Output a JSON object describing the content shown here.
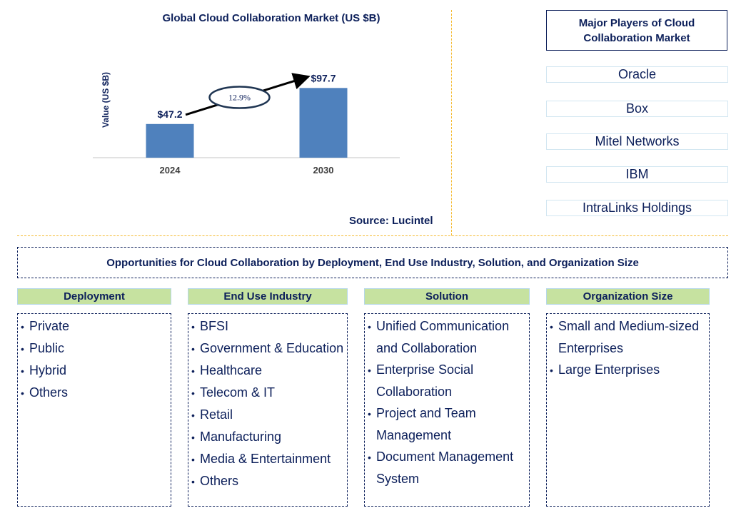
{
  "chart_data": {
    "type": "bar",
    "title": "Global Cloud Collaboration Market (US $B)",
    "xlabel": "",
    "ylabel": "Value (US $B)",
    "categories": [
      "2024",
      "2030"
    ],
    "values": [
      47.2,
      97.7
    ],
    "data_labels": [
      "$47.2",
      "$97.7"
    ],
    "ylim": [
      0,
      100
    ],
    "grid": false,
    "bar_color": "#4f81bd",
    "annotation": {
      "type": "cagr-arrow",
      "label": "12.9%"
    },
    "source": "Source: Lucintel"
  },
  "players": {
    "header": "Major Players of Cloud Collaboration Market",
    "items": [
      "Oracle",
      "Box",
      "Mitel Networks",
      "IBM",
      "IntraLinks Holdings"
    ]
  },
  "opportunities": {
    "title": "Opportunities for Cloud Collaboration by Deployment, End Use Industry, Solution, and Organization Size",
    "categories": [
      {
        "label": "Deployment",
        "items": [
          "Private",
          "Public",
          "Hybrid",
          "Others"
        ]
      },
      {
        "label": "End Use Industry",
        "items": [
          "BFSI",
          "Government & Education",
          "Healthcare",
          "Telecom & IT",
          "Retail",
          "Manufacturing",
          "Media & Entertainment",
          "Others"
        ]
      },
      {
        "label": "Solution",
        "items": [
          "Unified Communication and Collaboration",
          "Enterprise Social Collaboration",
          "Project and Team Management",
          "Document Management System"
        ]
      },
      {
        "label": "Organization Size",
        "items": [
          "Small and Medium-sized Enterprises",
          "Large Enterprises"
        ]
      }
    ]
  },
  "colors": {
    "text": "#0c1f5a",
    "divider": "#f5b92d",
    "category_header": "#c6e2a0",
    "player_border": "#d2e6f1"
  }
}
